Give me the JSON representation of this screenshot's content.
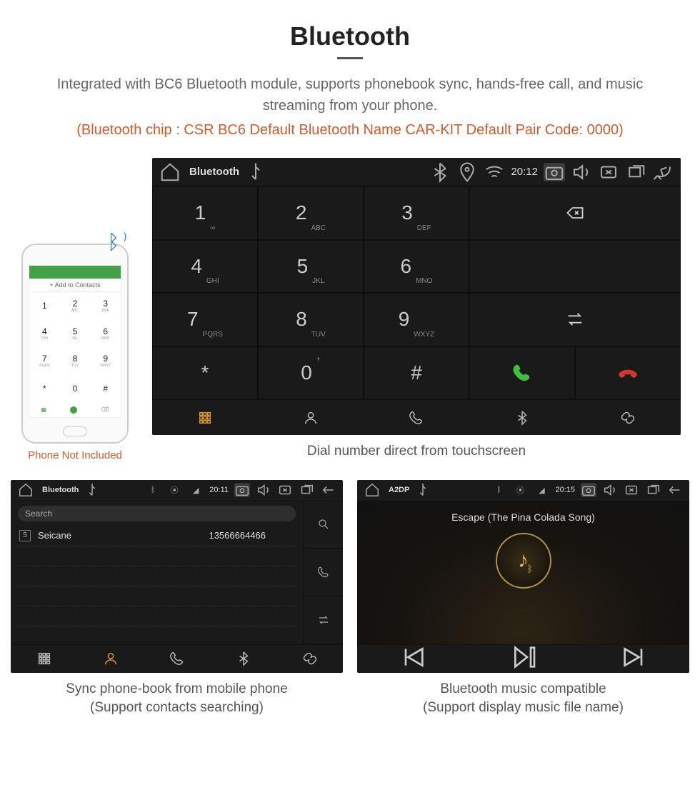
{
  "header": {
    "title": "Bluetooth",
    "description": "Integrated with BC6 Bluetooth module, supports phonebook sync, hands-free call, and music streaming from your phone.",
    "spec": "(Bluetooth chip : CSR BC6     Default Bluetooth Name CAR-KIT     Default Pair Code: 0000)"
  },
  "phone": {
    "add_to_contacts": "+  Add to Contacts",
    "keys": [
      "1",
      "2",
      "3",
      "4",
      "5",
      "6",
      "7",
      "8",
      "9",
      "*",
      "0",
      "#"
    ],
    "sublabels": [
      "",
      "ABC",
      "DEF",
      "GHI",
      "JKL",
      "MNO",
      "PQRS",
      "TUV",
      "WXYZ",
      "",
      "",
      ""
    ],
    "note": "Phone Not Included"
  },
  "dialer": {
    "status": {
      "title": "Bluetooth",
      "time": "20:12"
    },
    "keys": [
      {
        "num": "1",
        "ltr": "∞"
      },
      {
        "num": "2",
        "ltr": "ABC"
      },
      {
        "num": "3",
        "ltr": "DEF"
      },
      {
        "num": "4",
        "ltr": "GHI"
      },
      {
        "num": "5",
        "ltr": "JKL"
      },
      {
        "num": "6",
        "ltr": "MNO"
      },
      {
        "num": "7",
        "ltr": "PQRS"
      },
      {
        "num": "8",
        "ltr": "TUV"
      },
      {
        "num": "9",
        "ltr": "WXYZ"
      },
      {
        "num": "*",
        "ltr": ""
      },
      {
        "num": "0",
        "ltr": "+",
        "sup": true
      },
      {
        "num": "#",
        "ltr": ""
      }
    ],
    "caption": "Dial number direct from touchscreen"
  },
  "phonebook": {
    "status": {
      "title": "Bluetooth",
      "time": "20:11"
    },
    "search_placeholder": "Search",
    "contact": {
      "initial": "S",
      "name": "Seicane",
      "number": "13566664466"
    },
    "caption_l1": "Sync phone-book from mobile phone",
    "caption_l2": "(Support contacts searching)"
  },
  "music": {
    "status": {
      "title": "A2DP",
      "time": "20:15"
    },
    "song": "Escape (The Pina Colada Song)",
    "caption_l1": "Bluetooth music compatible",
    "caption_l2": "(Support display music file name)"
  }
}
